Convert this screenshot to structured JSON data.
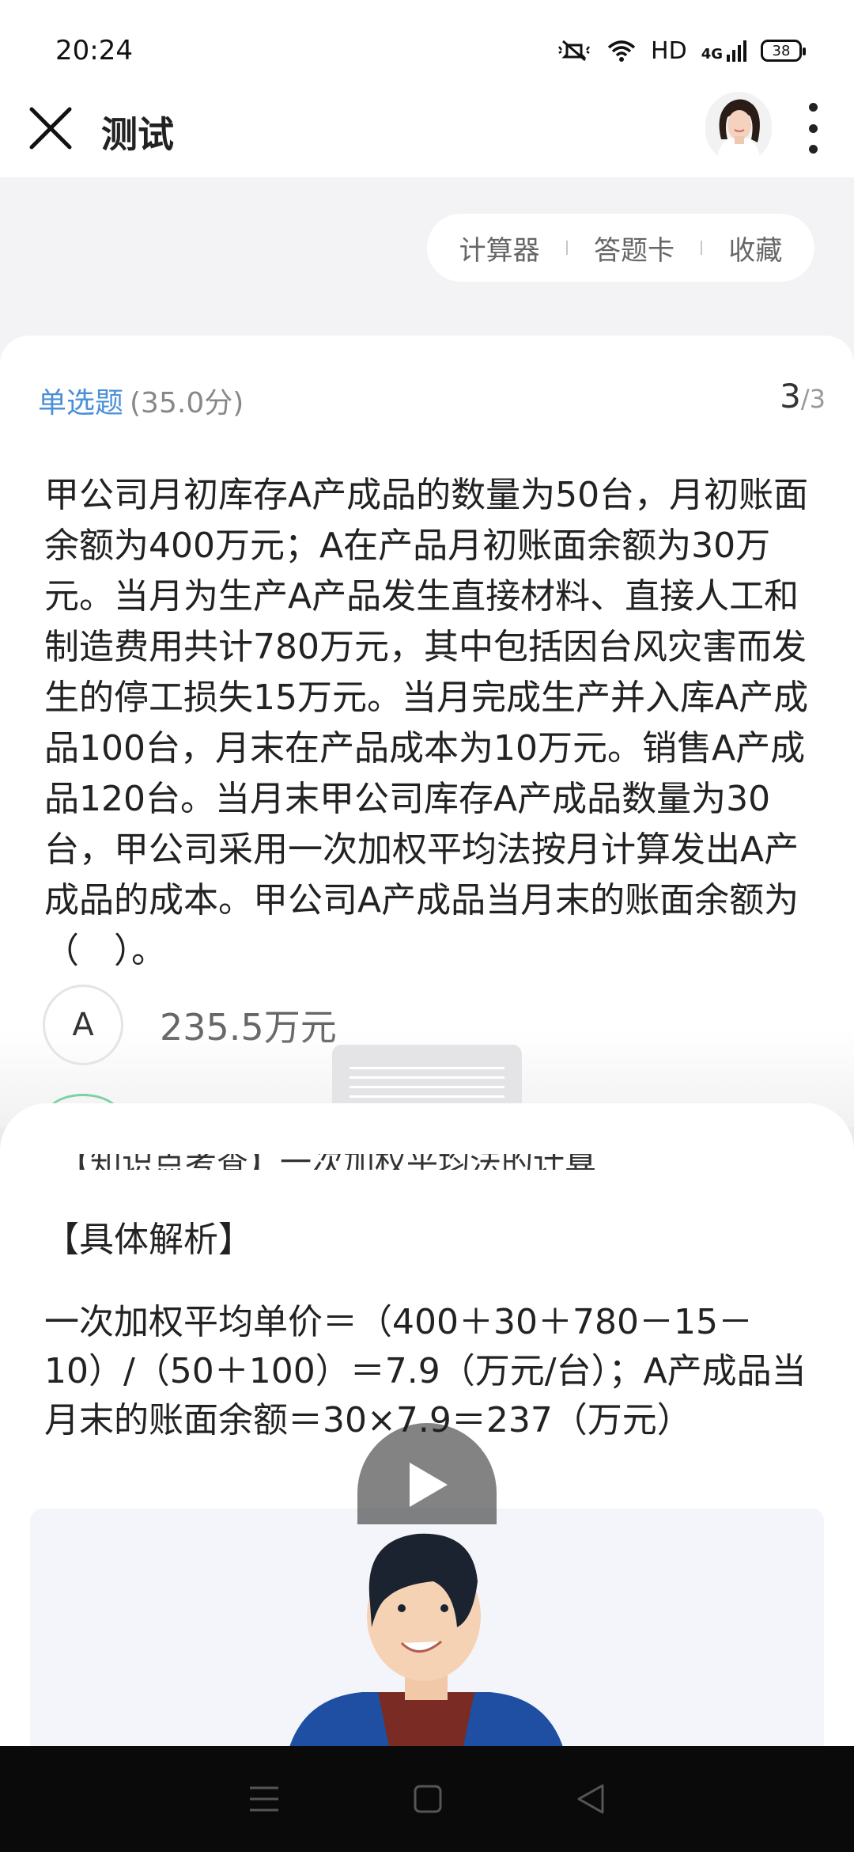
{
  "status_bar": {
    "time": "20:24",
    "network_label": "HD",
    "network_type": "4G",
    "battery": "38",
    "icons": [
      "mute-icon",
      "wifi-icon",
      "signal-icon",
      "battery-icon"
    ]
  },
  "header": {
    "title": "测试",
    "icons": [
      "close-icon",
      "avatar",
      "more-icon"
    ]
  },
  "toolbar": {
    "calculator": "计算器",
    "answer_card": "答题卡",
    "favorite": "收藏"
  },
  "question": {
    "type": "单选题",
    "score": "(35.0分)",
    "current": "3",
    "total": "/3",
    "text": "甲公司月初库存A产成品的数量为50台，月初账面余额为400万元；A在产品月初账面余额为30万元。当月为生产A产品发生直接材料、直接人工和制造费用共计780万元，其中包括因台风灾害而发生的停工损失15万元。当月完成生产并入库A产成品100台，月末在产品成本为10万元。销售A产成品120台。当月末甲公司库存A产成品数量为30台，甲公司采用一次加权平均法按月计算发出A产成品的成本。甲公司A产成品当月末的账面余额为（　）。",
    "options": [
      {
        "label": "A",
        "text": "235.5万元"
      }
    ]
  },
  "analysis": {
    "cut_line": "【知识点考查】一次加权平均法的计算",
    "heading": "【具体解析】",
    "body": "一次加权平均单价＝（400＋30＋780－15－10）/（50＋100）＝7.9（万元/台）；A产成品当月末的账面余额＝30×7.9＝237（万元）"
  },
  "colors": {
    "accent": "#4a90d9",
    "correct": "#3cc27a",
    "background": "#f3f3f5"
  }
}
